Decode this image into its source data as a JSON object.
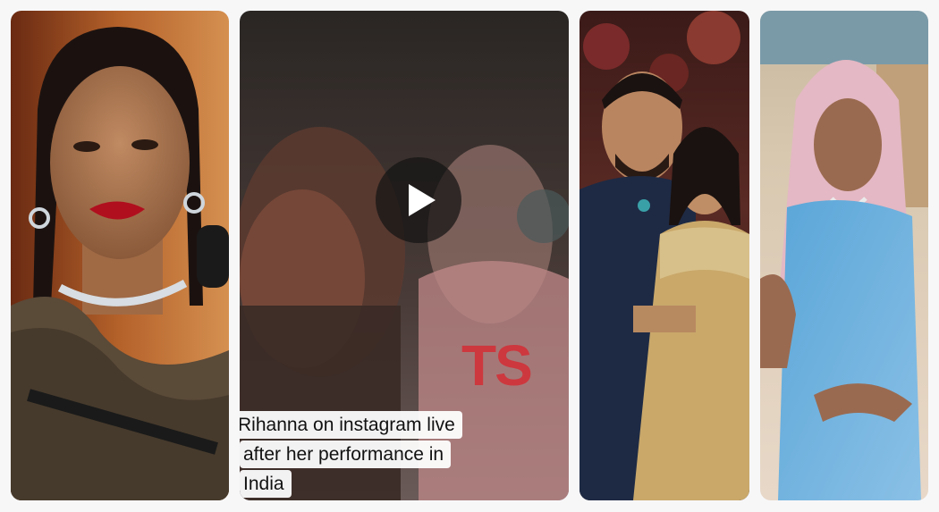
{
  "gallery": {
    "cards": [
      {
        "name": "Rihanna portrait",
        "type": "image"
      },
      {
        "name": "Instagram live video",
        "type": "video"
      },
      {
        "name": "Couple photo",
        "type": "image"
      },
      {
        "name": "Rihanna in hooded saree",
        "type": "image"
      }
    ],
    "video": {
      "caption_lines": [
        "Rihanna on instagram live",
        "after her performance in",
        "India"
      ],
      "watermark": "TS",
      "play_icon": "play-icon"
    }
  },
  "colors": {
    "page_bg": "#f7f7f8",
    "watermark": "#dc1e28",
    "play_bg": "#141414"
  }
}
